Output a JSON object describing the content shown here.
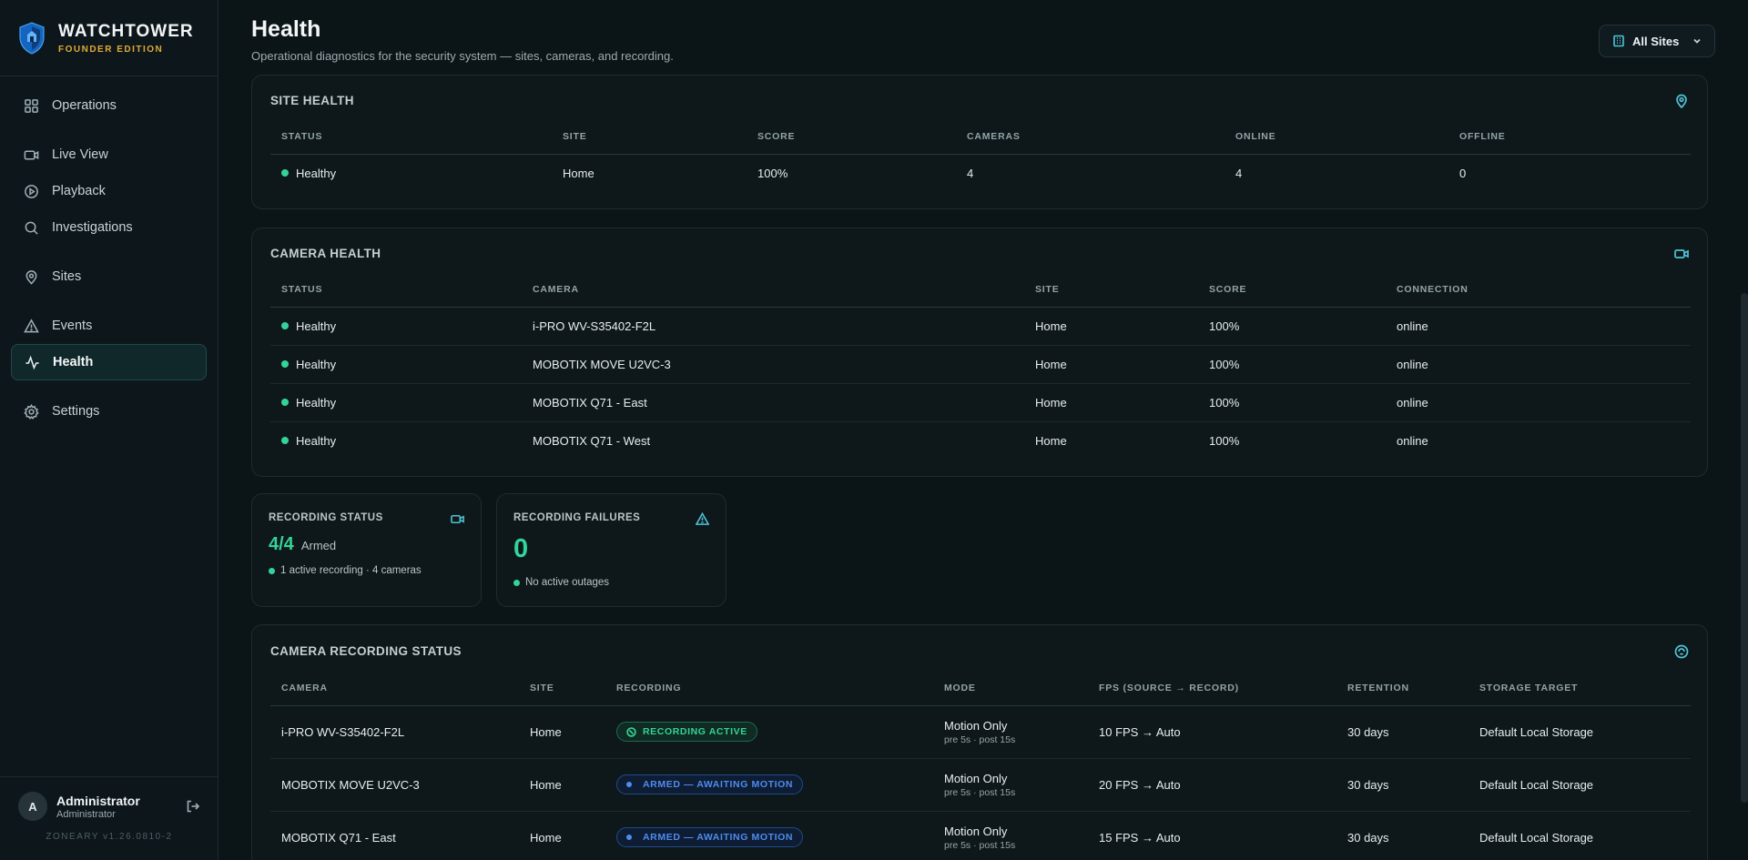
{
  "brand": {
    "name": "WATCHTOWER",
    "edition": "FOUNDER EDITION"
  },
  "nav": [
    {
      "label": "Operations",
      "icon": "grid-icon"
    },
    {
      "label": "Live View",
      "icon": "video-icon"
    },
    {
      "label": "Playback",
      "icon": "play-icon"
    },
    {
      "label": "Investigations",
      "icon": "search-icon"
    },
    {
      "label": "Sites",
      "icon": "map-pin-icon"
    },
    {
      "label": "Events",
      "icon": "alert-icon"
    },
    {
      "label": "Health",
      "icon": "activity-icon",
      "active": true
    },
    {
      "label": "Settings",
      "icon": "gear-icon"
    }
  ],
  "user": {
    "initial": "A",
    "name": "Administrator",
    "role": "Administrator",
    "version": "ZONEARY v1.26.0810-2"
  },
  "header": {
    "title": "Health",
    "subtitle": "Operational diagnostics for the security system — sites, cameras, and recording.",
    "site_filter": "All Sites"
  },
  "site_health": {
    "title": "SITE HEALTH",
    "columns": [
      "STATUS",
      "SITE",
      "SCORE",
      "CAMERAS",
      "ONLINE",
      "OFFLINE"
    ],
    "rows": [
      {
        "status": "Healthy",
        "site": "Home",
        "score": "100%",
        "cameras": "4",
        "online": "4",
        "offline": "0"
      }
    ]
  },
  "camera_health": {
    "title": "CAMERA HEALTH",
    "columns": [
      "STATUS",
      "CAMERA",
      "SITE",
      "SCORE",
      "CONNECTION"
    ],
    "rows": [
      {
        "status": "Healthy",
        "camera": "i-PRO WV-S35402-F2L",
        "site": "Home",
        "score": "100%",
        "connection": "online"
      },
      {
        "status": "Healthy",
        "camera": "MOBOTIX MOVE U2VC-3",
        "site": "Home",
        "score": "100%",
        "connection": "online"
      },
      {
        "status": "Healthy",
        "camera": "MOBOTIX Q71 - East",
        "site": "Home",
        "score": "100%",
        "connection": "online"
      },
      {
        "status": "Healthy",
        "camera": "MOBOTIX Q71 - West",
        "site": "Home",
        "score": "100%",
        "connection": "online"
      }
    ]
  },
  "recording_status": {
    "title": "RECORDING STATUS",
    "value": "4/4",
    "value_label": "Armed",
    "note": "1 active recording · 4 cameras"
  },
  "recording_failures": {
    "title": "RECORDING FAILURES",
    "value": "0",
    "note": "No active outages"
  },
  "camera_recording": {
    "title": "CAMERA RECORDING STATUS",
    "columns": [
      "CAMERA",
      "SITE",
      "RECORDING",
      "MODE",
      "FPS (SOURCE → RECORD)",
      "RETENTION",
      "STORAGE TARGET"
    ],
    "rows": [
      {
        "camera": "i-PRO WV-S35402-F2L",
        "site": "Home",
        "recording": "RECORDING ACTIVE",
        "kind": "active",
        "mode": "Motion Only",
        "mode_sub": "pre 5s · post 15s",
        "fps": "10 FPS → Auto",
        "retention": "30 days",
        "storage": "Default Local Storage"
      },
      {
        "camera": "MOBOTIX MOVE U2VC-3",
        "site": "Home",
        "recording": "ARMED — AWAITING MOTION",
        "kind": "armed",
        "mode": "Motion Only",
        "mode_sub": "pre 5s · post 15s",
        "fps": "20 FPS → Auto",
        "retention": "30 days",
        "storage": "Default Local Storage"
      },
      {
        "camera": "MOBOTIX Q71 - East",
        "site": "Home",
        "recording": "ARMED — AWAITING MOTION",
        "kind": "armed",
        "mode": "Motion Only",
        "mode_sub": "pre 5s · post 15s",
        "fps": "15 FPS → Auto",
        "retention": "30 days",
        "storage": "Default Local Storage"
      }
    ]
  },
  "colors": {
    "accent": "#4fc3d6",
    "healthy": "#34d399",
    "armed": "#4e8cf0",
    "brand_gold": "#e0a93a"
  }
}
